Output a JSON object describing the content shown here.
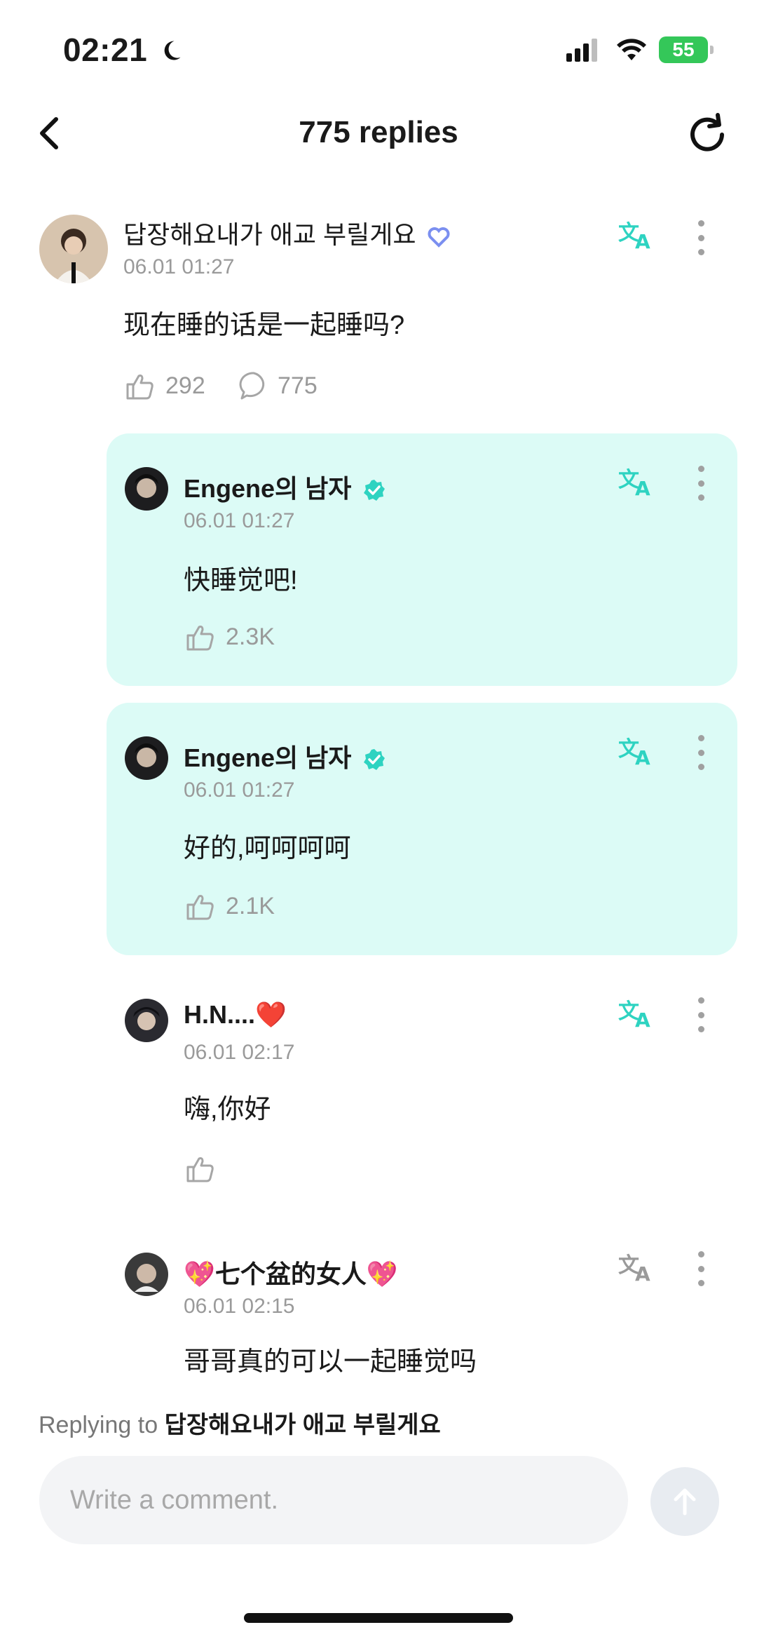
{
  "status_bar": {
    "time": "02:21",
    "battery": "55"
  },
  "header": {
    "title": "775 replies"
  },
  "main_comment": {
    "user": "답장해요내가 애교 부릴게요",
    "date": "06.01 01:27",
    "text": "现在睡的话是一起睡吗?",
    "likes": "292",
    "replies": "775"
  },
  "replies": [
    {
      "user": "Engene의 남자",
      "date": "06.01 01:27",
      "text": "快睡觉吧!",
      "likes": "2.3K",
      "verified": true
    },
    {
      "user": "Engene의 남자",
      "date": "06.01 01:27",
      "text": "好的,呵呵呵呵",
      "likes": "2.1K",
      "verified": true
    },
    {
      "user": "H.N....❤️",
      "date": "06.01 02:17",
      "text": "嗨,你好",
      "likes": ""
    },
    {
      "user": "💖七个盆的女人💖",
      "date": "06.01 02:15",
      "text": "哥哥真的可以一起睡觉吗",
      "likes": ""
    }
  ],
  "footer": {
    "replying_prefix": "Replying to",
    "replying_to": "답장해요내가 애교 부릴게요",
    "input_placeholder": "Write a comment."
  },
  "colors": {
    "accent": "#2ed3c1",
    "card_bg": "#dcfbf6"
  }
}
